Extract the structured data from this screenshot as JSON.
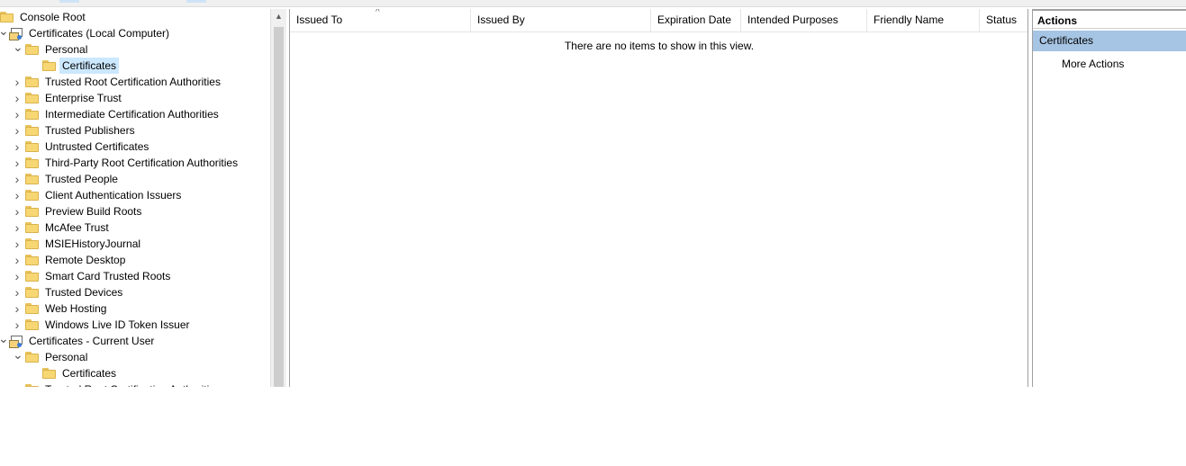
{
  "tree": {
    "items": [
      {
        "label": "Console Root",
        "level": 0,
        "chevron": "",
        "icon": "folder",
        "selected": false
      },
      {
        "label": "Certificates (Local Computer)",
        "level": 1,
        "chevron": "expanded",
        "icon": "store",
        "selected": false
      },
      {
        "label": "Personal",
        "level": 2,
        "chevron": "expanded",
        "icon": "folder",
        "selected": false
      },
      {
        "label": "Certificates",
        "level": 3,
        "chevron": "",
        "icon": "folder",
        "selected": true
      },
      {
        "label": "Trusted Root Certification Authorities",
        "level": 2,
        "chevron": "collapsed",
        "icon": "folder",
        "selected": false
      },
      {
        "label": "Enterprise Trust",
        "level": 2,
        "chevron": "collapsed",
        "icon": "folder",
        "selected": false
      },
      {
        "label": "Intermediate Certification Authorities",
        "level": 2,
        "chevron": "collapsed",
        "icon": "folder",
        "selected": false
      },
      {
        "label": "Trusted Publishers",
        "level": 2,
        "chevron": "collapsed",
        "icon": "folder",
        "selected": false
      },
      {
        "label": "Untrusted Certificates",
        "level": 2,
        "chevron": "collapsed",
        "icon": "folder",
        "selected": false
      },
      {
        "label": "Third-Party Root Certification Authorities",
        "level": 2,
        "chevron": "collapsed",
        "icon": "folder",
        "selected": false
      },
      {
        "label": "Trusted People",
        "level": 2,
        "chevron": "collapsed",
        "icon": "folder",
        "selected": false
      },
      {
        "label": "Client Authentication Issuers",
        "level": 2,
        "chevron": "collapsed",
        "icon": "folder",
        "selected": false
      },
      {
        "label": "Preview Build Roots",
        "level": 2,
        "chevron": "collapsed",
        "icon": "folder",
        "selected": false
      },
      {
        "label": "McAfee Trust",
        "level": 2,
        "chevron": "collapsed",
        "icon": "folder",
        "selected": false
      },
      {
        "label": "MSIEHistoryJournal",
        "level": 2,
        "chevron": "collapsed",
        "icon": "folder",
        "selected": false
      },
      {
        "label": "Remote Desktop",
        "level": 2,
        "chevron": "collapsed",
        "icon": "folder",
        "selected": false
      },
      {
        "label": "Smart Card Trusted Roots",
        "level": 2,
        "chevron": "collapsed",
        "icon": "folder",
        "selected": false
      },
      {
        "label": "Trusted Devices",
        "level": 2,
        "chevron": "collapsed",
        "icon": "folder",
        "selected": false
      },
      {
        "label": "Web Hosting",
        "level": 2,
        "chevron": "collapsed",
        "icon": "folder",
        "selected": false
      },
      {
        "label": "Windows Live ID Token Issuer",
        "level": 2,
        "chevron": "collapsed",
        "icon": "folder",
        "selected": false
      },
      {
        "label": "Certificates - Current User",
        "level": 1,
        "chevron": "expanded",
        "icon": "store",
        "selected": false
      },
      {
        "label": "Personal",
        "level": 2,
        "chevron": "expanded",
        "icon": "folder",
        "selected": false
      },
      {
        "label": "Certificates",
        "level": 3,
        "chevron": "",
        "icon": "folder",
        "selected": false
      },
      {
        "label": "Trusted Root Certification Authorities",
        "level": 2,
        "chevron": "collapsed",
        "icon": "folder",
        "selected": false
      }
    ]
  },
  "list": {
    "columns": [
      "Issued To",
      "Issued By",
      "Expiration Date",
      "Intended Purposes",
      "Friendly Name",
      "Status"
    ],
    "sort_indicator": "^",
    "empty_message": "There are no items to show in this view."
  },
  "actions": {
    "title": "Actions",
    "section": "Certificates",
    "items": [
      "More Actions"
    ]
  },
  "colors": {
    "selection": "#cce8ff",
    "action_section": "#a6c4e3"
  }
}
